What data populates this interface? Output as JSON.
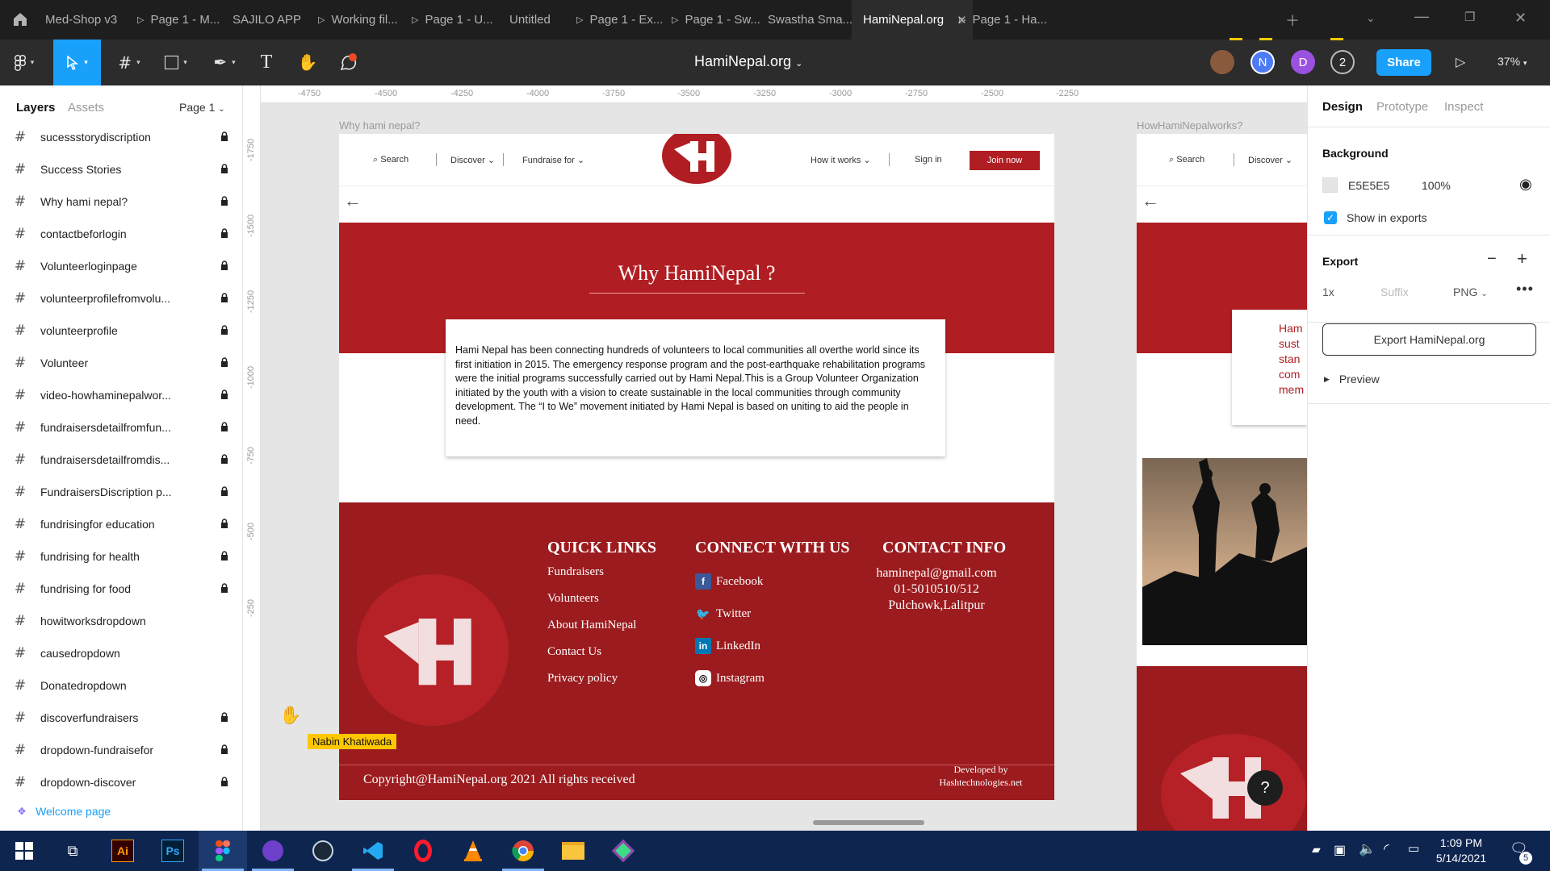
{
  "tabs": [
    {
      "label": "Med-Shop v3",
      "proto": false
    },
    {
      "label": "Page 1 - M...",
      "proto": true
    },
    {
      "label": "SAJILO APP",
      "proto": false
    },
    {
      "label": "Working fil...",
      "proto": true
    },
    {
      "label": "Page 1 - U...",
      "proto": true
    },
    {
      "label": "Untitled",
      "proto": false
    },
    {
      "label": "Page 1 - Ex...",
      "proto": true
    },
    {
      "label": "Page 1 - Sw...",
      "proto": true
    },
    {
      "label": "Swastha Sma...",
      "proto": false
    },
    {
      "label": "HamiNepal.org",
      "proto": false,
      "active": true
    },
    {
      "label": "Page 1 - Ha...",
      "proto": true
    }
  ],
  "toolbar": {
    "doc_title": "HamiNepal.org",
    "avatars": [
      "N",
      "D",
      "2"
    ],
    "share_label": "Share",
    "zoom": "37%"
  },
  "left_panel": {
    "tab_layers": "Layers",
    "tab_assets": "Assets",
    "page_selector": "Page 1",
    "layers": [
      {
        "name": "sucessstorydiscription",
        "locked": true
      },
      {
        "name": "Success Stories",
        "locked": true
      },
      {
        "name": "Why hami nepal?",
        "locked": true
      },
      {
        "name": "contactbeforlogin",
        "locked": true
      },
      {
        "name": "Volunteerloginpage",
        "locked": true
      },
      {
        "name": "volunteerprofilefromvolu...",
        "locked": true
      },
      {
        "name": "volunteerprofile",
        "locked": true
      },
      {
        "name": "Volunteer",
        "locked": true
      },
      {
        "name": "video-howhaminepalwor...",
        "locked": true
      },
      {
        "name": "fundraisersdetailfromfun...",
        "locked": true
      },
      {
        "name": "fundraisersdetailfromdis...",
        "locked": true
      },
      {
        "name": "FundraisersDiscription p...",
        "locked": true
      },
      {
        "name": "fundrisingfor education",
        "locked": true
      },
      {
        "name": "fundrising for health",
        "locked": true
      },
      {
        "name": "fundrising for food",
        "locked": true
      },
      {
        "name": "howitworksdropdown",
        "locked": false
      },
      {
        "name": "causedropdown",
        "locked": false
      },
      {
        "name": "Donatedropdown",
        "locked": false
      },
      {
        "name": "discoverfundraisers",
        "locked": true
      },
      {
        "name": "dropdown-fundraisefor",
        "locked": true
      },
      {
        "name": "dropdown-discover",
        "locked": true
      }
    ],
    "welcome_page": "Welcome page"
  },
  "rulers": {
    "top": [
      "-4750",
      "-4500",
      "-4250",
      "-4000",
      "-3750",
      "-3500",
      "-3250",
      "-3000",
      "-2750",
      "-2500",
      "-2250"
    ],
    "left": [
      "-1750",
      "-1500",
      "-1250",
      "-1000",
      "-750",
      "-500",
      "-250"
    ]
  },
  "canvas": {
    "frame1_label": "Why hami nepal?",
    "frame2_label": "HowHamiNepalworks?",
    "nav": {
      "search": "Search",
      "discover": "Discover",
      "fundraise": "Fundraise for",
      "how": "How it works",
      "signin": "Sign in",
      "join": "Join now"
    },
    "hero_title": "Why HamiNepal ?",
    "body_text": "Hami Nepal has been connecting hundreds of volunteers to local communities all overthe world since its first initiation in 2015. The emergency response program and the post-earthquake rehabilitation programs were the initial programs successfully carried out by Hami Nepal.This is a Group Volunteer Organization initiated by the youth with a vision to create sustainable in the local communities through community development. The “I to We” movement initiated by Hami Nepal is based on uniting to aid the people in need.",
    "footer": {
      "quick_links_title": "QUICK LINKS",
      "quick_links": [
        "Fundraisers",
        "Volunteers",
        "About HamiNepal",
        "Contact Us",
        "Privacy policy"
      ],
      "connect_title": "CONNECT WITH US",
      "social": [
        "Facebook",
        "Twitter",
        "LinkedIn",
        "Instagram"
      ],
      "contact_title": "CONTACT INFO",
      "contact": [
        "haminepal@gmail.com",
        "01-5010510/512",
        "Pulchowk,Lalitpur"
      ],
      "copyright": "Copyright@HamiNepal.org 2021 All rights received",
      "developed_by": "Developed by",
      "developer": "Hashtechnologies.net"
    },
    "frame2_text": [
      "Ham",
      "sust",
      "stan",
      "com",
      "mem"
    ],
    "cursor_label": "Nabin Khatiwada"
  },
  "right_panel": {
    "tabs": [
      "Design",
      "Prototype",
      "Inspect"
    ],
    "background_title": "Background",
    "bg_hex": "E5E5E5",
    "bg_opacity": "100%",
    "show_in_exports": "Show in exports",
    "export_title": "Export",
    "export_scale": "1x",
    "suffix_placeholder": "Suffix",
    "export_format": "PNG",
    "export_button": "Export HamiNepal.org",
    "preview": "Preview"
  },
  "taskbar": {
    "time": "1:09 PM",
    "date": "5/14/2021",
    "notif_count": "5"
  },
  "colors": {
    "figma_blue": "#18a0fb",
    "brand_red": "#b01e23",
    "footer_red": "#9b1b1e",
    "taskbar": "#0e2550"
  }
}
